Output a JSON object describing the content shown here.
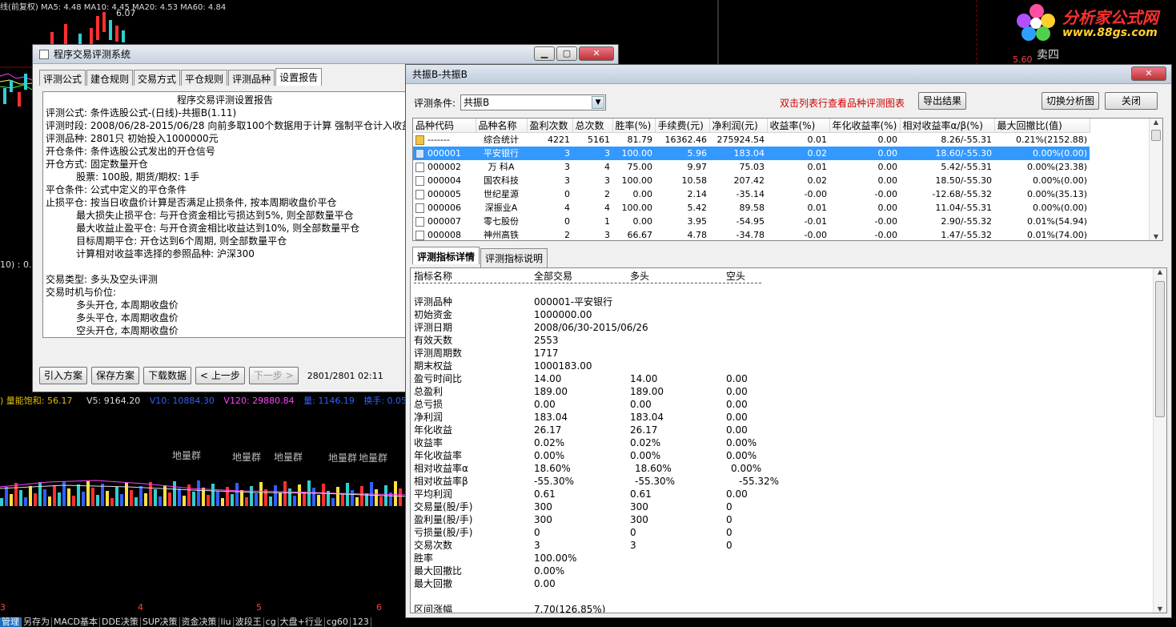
{
  "background": {
    "top_strip": "线(前复权) MA5: 4.48  MA10: 4.45  MA20: 4.53  MA60: 4.84",
    "peak_label": "6.07",
    "side_label": "10) : 0.",
    "volume_strip": [
      {
        "text": ") 量能饱和: 56.17",
        "color": "#e0c000"
      },
      {
        "text": "V5: 9164.20",
        "color": "#dddddd"
      },
      {
        "text": "V10: 10884.30",
        "color": "#3060ff"
      },
      {
        "text": "V120: 29880.84",
        "color": "#ff40ff"
      },
      {
        "text": "量: 1146.19",
        "color": "#3060ff"
      },
      {
        "text": "换手: 0.05",
        "color": "#3060ff"
      }
    ],
    "chart_labels": [
      "地量群",
      "地量群",
      "地量群",
      "地量群",
      "地量群"
    ],
    "axis_ticks": [
      "3",
      "4",
      "5",
      "6"
    ],
    "bottom_tabs": [
      "管理",
      "另存为",
      "MACD基本",
      "DDE决策",
      "SUP决策",
      "资金决策",
      "liu",
      "波段王",
      "cg",
      "大盘+行业",
      "cg60",
      "123"
    ],
    "logo_name": "分析家公式网",
    "logo_url": "www.88gs.com",
    "right_label": "卖四",
    "right_price": "5.60"
  },
  "win1": {
    "title": "程序交易评测系统",
    "tabs": [
      "评测公式",
      "建仓规则",
      "交易方式",
      "平仓规则",
      "评测品种",
      "设置报告"
    ],
    "active_tab": 5,
    "report_title": "程序交易评测设置报告",
    "report_lines": [
      "评测公式: 条件选股公式-(日线)-共振B(1.11)",
      "评测时段: 2008/06/28-2015/06/28 向前多取100个数据用于计算 强制平仓计入收益",
      "评测品种: 2801只 初始投入1000000元",
      "开仓条件: 条件选股公式发出的开仓信号",
      "开仓方式: 固定数量开仓",
      "          股票: 100股, 期货/期权: 1手",
      "平仓条件: 公式中定义的平仓条件",
      "止损平仓: 按当日收盘价计算是否满足止损条件, 按本周期收盘价平仓",
      "          最大损失止损平仓: 与开仓资金相比亏损达到5%, 则全部数量平仓",
      "          最大收益止盈平仓: 与开仓资金相比收益达到10%, 则全部数量平仓",
      "          目标周期平仓: 开仓达到6个周期, 则全部数量平仓",
      "          计算相对收益率选择的参照品种: 沪深300",
      "",
      "交易类型: 多头及空头评测",
      "交易时机与价位:",
      "          多头开仓, 本周期收盘价",
      "          多头平仓, 本周期收盘价",
      "          空头开仓, 本周期收盘价"
    ],
    "buttons": [
      "引入方案",
      "保存方案",
      "下载数据",
      "< 上一步",
      "下一步 >"
    ],
    "status": "2801/2801  02:11"
  },
  "win2": {
    "title": "共振B-共振B",
    "condition_label": "评测条件:",
    "condition_value": "共振B",
    "hint": "双击列表行查看品种评测图表",
    "export_btn": "导出结果",
    "switch_btn": "切换分析图",
    "close_btn": "关闭",
    "columns": [
      "品种代码",
      "品种名称",
      "盈利次数",
      "总次数",
      "胜率(%)",
      "手续费(元)",
      "净利润(元)",
      "收益率(%)",
      "年化收益率(%)",
      "相对收益率α/β(%)",
      "最大回撤比(值)"
    ],
    "rows": [
      {
        "icon": "sum",
        "code": "-------",
        "name": "综合统计",
        "win": "4221",
        "total": "5161",
        "rate": "81.79",
        "fee": "16362.46",
        "profit": "275924.54",
        "ret": "0.01",
        "annual": "0.00",
        "ab": "8.26/-55.31",
        "dd": "0.21%(2152.88)"
      },
      {
        "icon": "blue",
        "code": "000001",
        "name": "平安银行",
        "win": "3",
        "total": "3",
        "rate": "100.00",
        "fee": "5.96",
        "profit": "183.04",
        "ret": "0.02",
        "annual": "0.00",
        "ab": "18.60/-55.30",
        "dd": "0.00%(0.00)"
      },
      {
        "icon": "doc",
        "code": "000002",
        "name": "万  科A",
        "win": "3",
        "total": "4",
        "rate": "75.00",
        "fee": "9.97",
        "profit": "75.03",
        "ret": "0.01",
        "annual": "0.00",
        "ab": "5.42/-55.31",
        "dd": "0.00%(23.38)"
      },
      {
        "icon": "doc",
        "code": "000004",
        "name": "国农科技",
        "win": "3",
        "total": "3",
        "rate": "100.00",
        "fee": "10.58",
        "profit": "207.42",
        "ret": "0.02",
        "annual": "0.00",
        "ab": "18.50/-55.30",
        "dd": "0.00%(0.00)"
      },
      {
        "icon": "doc",
        "code": "000005",
        "name": "世纪星源",
        "win": "0",
        "total": "2",
        "rate": "0.00",
        "fee": "2.14",
        "profit": "-35.14",
        "ret": "-0.00",
        "annual": "-0.00",
        "ab": "-12.68/-55.32",
        "dd": "0.00%(35.13)"
      },
      {
        "icon": "doc",
        "code": "000006",
        "name": "深振业A",
        "win": "4",
        "total": "4",
        "rate": "100.00",
        "fee": "5.42",
        "profit": "89.58",
        "ret": "0.01",
        "annual": "0.00",
        "ab": "11.04/-55.31",
        "dd": "0.00%(0.00)"
      },
      {
        "icon": "doc",
        "code": "000007",
        "name": "零七股份",
        "win": "0",
        "total": "1",
        "rate": "0.00",
        "fee": "3.95",
        "profit": "-54.95",
        "ret": "-0.01",
        "annual": "-0.00",
        "ab": "2.90/-55.32",
        "dd": "0.01%(54.94)"
      },
      {
        "icon": "doc",
        "code": "000008",
        "name": "神州高铁",
        "win": "2",
        "total": "3",
        "rate": "66.67",
        "fee": "4.78",
        "profit": "-34.78",
        "ret": "-0.00",
        "annual": "-0.00",
        "ab": "1.47/-55.32",
        "dd": "0.01%(74.00)"
      }
    ],
    "selected_row": 1,
    "detail_tabs": [
      "评测指标详情",
      "评测指标说明"
    ],
    "detail_header": [
      "指标名称",
      "全部交易",
      "多头",
      "空头"
    ],
    "detail_rows": [
      [
        "评测品种",
        "000001-平安银行",
        "",
        ""
      ],
      [
        "初始资金",
        "1000000.00",
        "",
        ""
      ],
      [
        "评测日期",
        "2008/06/30-2015/06/26",
        "",
        ""
      ],
      [
        "有效天数",
        "2553",
        "",
        ""
      ],
      [
        "评测周期数",
        "1717",
        "",
        ""
      ],
      [
        "期末权益",
        "1000183.00",
        "",
        ""
      ],
      [
        "盈亏时间比",
        "14.00",
        "14.00",
        "0.00"
      ],
      [
        "总盈利",
        "189.00",
        "189.00",
        "0.00"
      ],
      [
        "总亏损",
        "0.00",
        "0.00",
        "0.00"
      ],
      [
        "净利润",
        "183.04",
        "183.04",
        "0.00"
      ],
      [
        "年化收益",
        "26.17",
        "26.17",
        "0.00"
      ],
      [
        "收益率",
        "0.02%",
        "0.02%",
        "0.00%"
      ],
      [
        "年化收益率",
        "0.00%",
        "0.00%",
        "0.00%"
      ],
      [
        "相对收益率α",
        "18.60%",
        "18.60%",
        "0.00%"
      ],
      [
        "相对收益率β",
        "-55.30%",
        "-55.30%",
        "-55.32%"
      ],
      [
        "平均利润",
        "0.61",
        "0.61",
        "0.00"
      ],
      [
        "交易量(股/手)",
        "300",
        "300",
        "0"
      ],
      [
        "盈利量(股/手)",
        "300",
        "300",
        "0"
      ],
      [
        "亏损量(股/手)",
        "0",
        "0",
        "0"
      ],
      [
        "交易次数",
        "3",
        "3",
        "0"
      ],
      [
        "胜率",
        "100.00%",
        "",
        ""
      ],
      [
        "最大回撤比",
        "0.00%",
        "",
        ""
      ],
      [
        "最大回撤",
        "0.00",
        "",
        ""
      ],
      [
        "",
        "",
        "",
        ""
      ],
      [
        "区间涨幅",
        "7.70(126.85%)",
        "",
        ""
      ]
    ]
  }
}
